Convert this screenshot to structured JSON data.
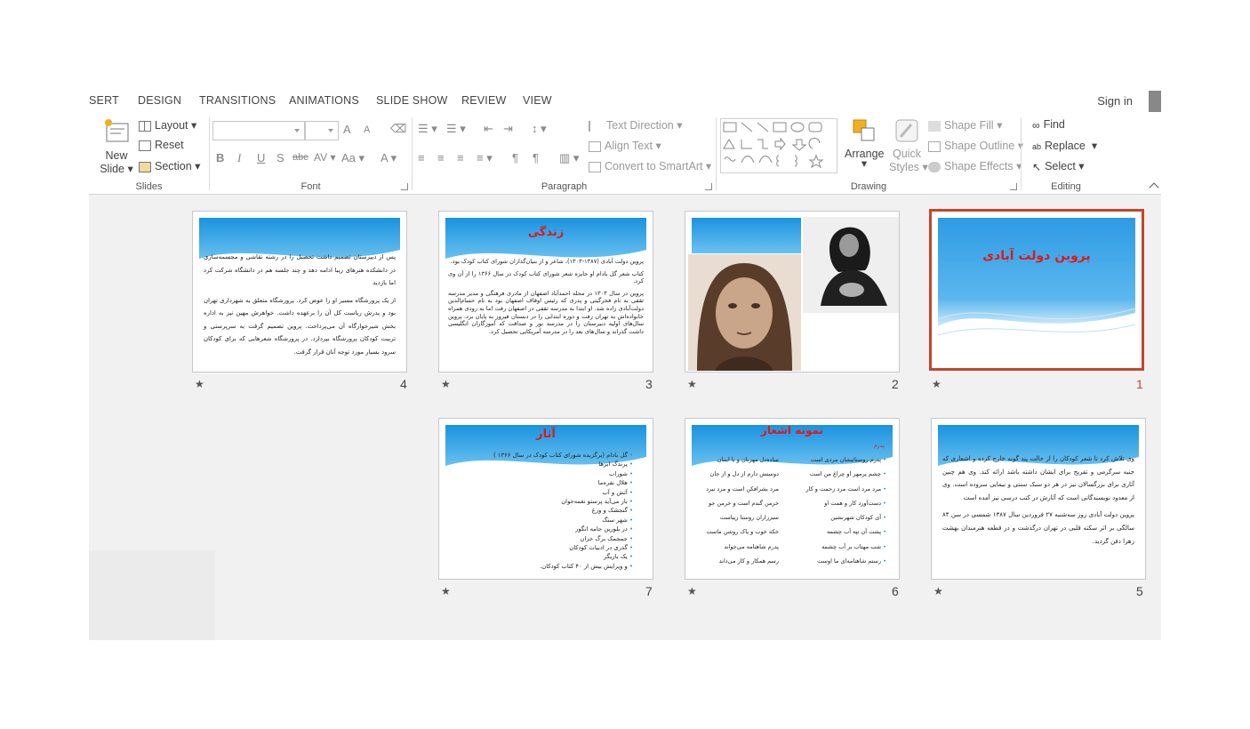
{
  "tabs": [
    "SERT",
    "DESIGN",
    "TRANSITIONS",
    "ANIMATIONS",
    "SLIDE SHOW",
    "REVIEW",
    "VIEW"
  ],
  "account": {
    "signin": "Sign in"
  },
  "ribbon": {
    "slides": {
      "new_slide": "New",
      "new_slide2": "Slide",
      "layout": "Layout",
      "reset": "Reset",
      "section": "Section",
      "label": "Slides"
    },
    "font": {
      "label": "Font",
      "bold": "B",
      "italic": "I",
      "underline": "U",
      "shadow": "S",
      "strike": "abc",
      "spacing": "AV",
      "case": "Aa",
      "color": "A",
      "grow": "A",
      "shrink": "A"
    },
    "paragraph": {
      "label": "Paragraph",
      "text_direction": "Text Direction",
      "align_text": "Align Text",
      "smartart": "Convert to SmartArt"
    },
    "drawing": {
      "label": "Drawing",
      "arrange": "Arrange",
      "quick": "Quick",
      "styles": "Styles",
      "shape_fill": "Shape Fill",
      "shape_outline": "Shape Outline",
      "shape_effects": "Shape Effects"
    },
    "editing": {
      "label": "Editing",
      "find": "Find",
      "replace": "Replace",
      "select": "Select"
    }
  },
  "slides": [
    {
      "number": "1",
      "title": "پروین دولت آبادی"
    },
    {
      "number": "2"
    },
    {
      "number": "3",
      "title": "زندگی",
      "paragraphs": [
        "پروین دولت آبادی (۱۳۸۷-۱۳۰۳)، شاعر و از بنیان‌گذاران شورای کتاب کودک بود.",
        "کتاب شعر گل بادام او جایزه شعر شورای کتاب کودک در سال ۱۳۶۶ را از آن وی کرد.",
        "پروین در سال ۱۳۰۳ در محله احمدآباد اصفهان از مادری فرهنگی و مدیر مدرسه ثقفی به نام فخرگیتی و پدری که رئیس اوقاف اصفهان بود به نام حسام‌الدین دولت‌آبادی زاده شد. او ابتدا به مدرسه ثقفی در اصفهان رفت اما به زودی همراه خانواده‌اش به تهران رفت و دوره ابتدایی را در دبستان فیروز به پایان برد. پروین سال‌های اولیه دبیرستان را در مدرسه نور و صداقت که آموزگاران انگلیسی داشت گذراند و سال‌های بعد را در مدرسه آمریکایی تحصیل کرد."
      ]
    },
    {
      "number": "4",
      "paragraphs": [
        "پس از دبیرستان تصمیم داشت تحصیل را در رشته نقاشی و مجسمه‌سازی در دانشکده هنرهای زیبا ادامه دهد و چند جلسه هم در دانشگاه شرکت کرد اما بازدید",
        "از یک پرورشگاه مسیر او را عوض کرد. پرورشگاه متعلق به شهرداری تهران بود و پدرش ریاست کل آن را برعهده داشت. خواهرش مهین نیز به اداره بخش شیرخوارگاه آن می‌پرداخت. پروین تصمیم گرفت به سرپرستی و تربیت کودکان پرورشگاه بپردازد. در پرورشگاه شعرهایی که برای کودکان سرود بسیار مورد توجه آنان قرار گرفت."
      ]
    },
    {
      "number": "5",
      "paragraphs": [
        "وی تلاش کرد تا شعر کودکان را از حالت پند گونه خارج کرده و اشعاری که جنبه سرگرمی و تفریح برای ایشان داشته باشد ارائه کند. وی هم چنین آثاری برای بزرگسالان نیز در هر دو سبک سنتی و نیمایی سروده است. وی از معدود نویسندگانی است که آثارش در کتب درسی نیز آمده است",
        "پروین دولت آبادی روز سه‌شنبه ۲۷ فروردین سال ۱۳۸۷ شمسی در سن ۸۴ سالگی بر اثر سکته قلبی در تهران درگذشت و در قطعه هنرمندان بهشت زهرا دفن گردید."
      ]
    },
    {
      "number": "6",
      "title": "نمونه اشعار",
      "subtitle": "پدرم",
      "right_col": [
        "پدرم روستائیشان مردی است",
        "چشم پرمهر او چراغ من است",
        "مرد مرد است مرد زحمت و کار",
        "دست‌آورد کار و همت او",
        "آی کودکان شهرنشین",
        "پشت آن تپه آب چشمه",
        "شب مهتاب بر آب چشمه",
        "رستم شاهنامه‌ای ما اوست"
      ],
      "left_col": [
        "ساده‌دل مهربان و با ایمان",
        "دوستش دارم از دل و از جان",
        "مرد بشرافکن است و مرد نبرد",
        "خرمن گندم است و خرمن جو",
        "سبززاران روستا زیباست",
        "خکه خوب و پاک روشن ماست",
        "پدرم شاهنامه می‌خواند",
        "رسم همکار و کار می‌داند"
      ]
    },
    {
      "number": "7",
      "title": "آثار",
      "items": [
        "گل بادام (برگزیده شورای کتاب کودک در سال ۱۳۶۶ )",
        "پرندگ ابرها",
        "شوراب",
        "هلال نقره‌ما",
        "آتش و آب",
        "باز می‌آید پرستو نغمه‌خوان",
        "گنجشک و وزغ",
        "شهر سنگ",
        "در بلورین جامه انگور",
        "جمجمک برگ خزان",
        "گذری در ادبیات کودکان",
        "یک بازیگر",
        "و ویرایش بیش از ۴۰ کتاب کودکان."
      ]
    }
  ],
  "star": "★"
}
